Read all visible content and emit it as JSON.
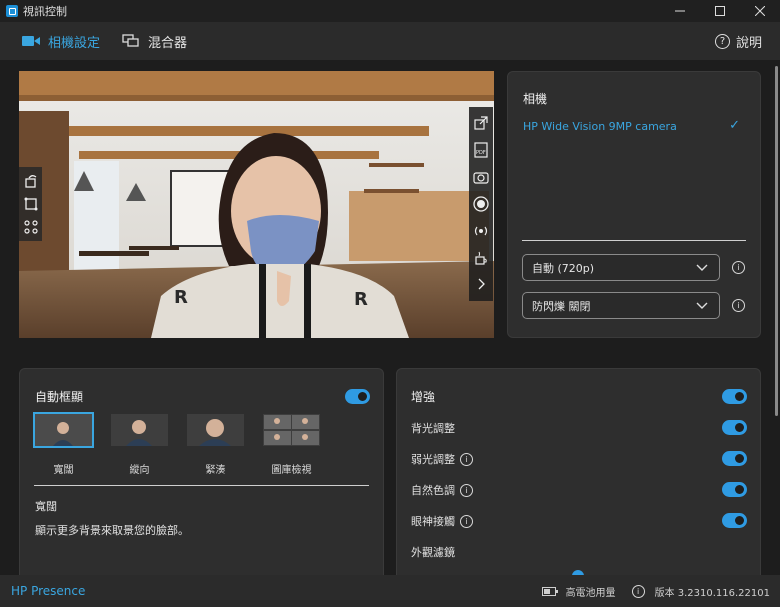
{
  "window": {
    "title": "視訊控制",
    "min_icon": "minimize-icon",
    "max_icon": "maximize-icon",
    "close_icon": "close-icon"
  },
  "nav": {
    "tabs": [
      {
        "label": "相機設定",
        "icon": "camera-icon",
        "active": true
      },
      {
        "label": "混合器",
        "icon": "mixer-icon",
        "active": false
      }
    ],
    "help_label": "說明"
  },
  "camera_panel": {
    "title": "相機",
    "camera_name": "HP Wide Vision 9MP camera",
    "resolution_select": "自動 (720p)",
    "flicker_select": "防閃爍 關閉"
  },
  "auto_frame": {
    "title": "自動框顯",
    "enabled": true,
    "options": [
      {
        "label": "寬闊",
        "selected": true
      },
      {
        "label": "縱向",
        "selected": false
      },
      {
        "label": "緊湊",
        "selected": false
      },
      {
        "label": "圖庫檢視",
        "selected": false
      }
    ],
    "selected_name": "寬闊",
    "description": "顯示更多背景來取景您的臉部。"
  },
  "enhance": {
    "title": "增強",
    "enabled": true,
    "items": [
      {
        "label": "背光調整",
        "has_info": false,
        "enabled": true
      },
      {
        "label": "弱光調整",
        "has_info": true,
        "enabled": true
      },
      {
        "label": "自然色調",
        "has_info": true,
        "enabled": true
      },
      {
        "label": "眼神接觸",
        "has_info": true,
        "enabled": true
      }
    ],
    "filter_label": "外觀濾鏡"
  },
  "status": {
    "brand": "HP Presence",
    "battery_label": "高電池用量",
    "version": "版本 3.2310.116.22101"
  },
  "colors": {
    "accent": "#3aa6e0",
    "toggle_on": "#2f9be3",
    "panel_bg": "#2e2e2e",
    "app_bg": "#1d1d1d"
  }
}
